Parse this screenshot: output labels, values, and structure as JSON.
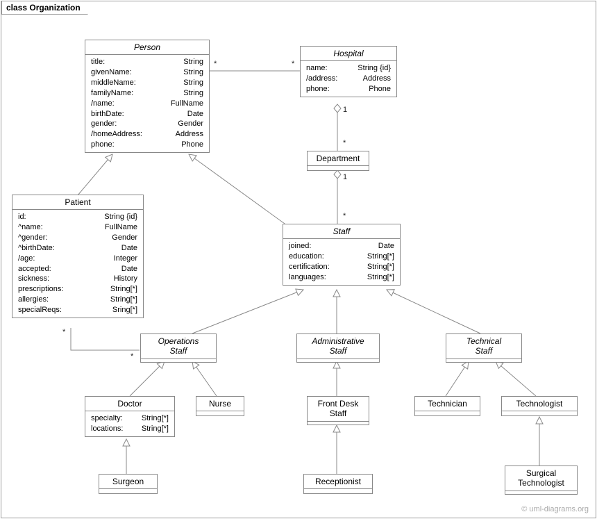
{
  "frame": {
    "title": "class Organization"
  },
  "watermark": "© uml-diagrams.org",
  "classes": {
    "person": {
      "name": "Person",
      "attrs": [
        {
          "n": "title:",
          "t": "String"
        },
        {
          "n": "givenName:",
          "t": "String"
        },
        {
          "n": "middleName:",
          "t": "String"
        },
        {
          "n": "familyName:",
          "t": "String"
        },
        {
          "n": "/name:",
          "t": "FullName"
        },
        {
          "n": "birthDate:",
          "t": "Date"
        },
        {
          "n": "gender:",
          "t": "Gender"
        },
        {
          "n": "/homeAddress:",
          "t": "Address"
        },
        {
          "n": "phone:",
          "t": "Phone"
        }
      ]
    },
    "hospital": {
      "name": "Hospital",
      "attrs": [
        {
          "n": "name:",
          "t": "String {id}"
        },
        {
          "n": "/address:",
          "t": "Address"
        },
        {
          "n": "phone:",
          "t": "Phone"
        }
      ]
    },
    "department": {
      "name": "Department"
    },
    "patient": {
      "name": "Patient",
      "attrs": [
        {
          "n": "id:",
          "t": "String {id}"
        },
        {
          "n": "^name:",
          "t": "FullName"
        },
        {
          "n": "^gender:",
          "t": "Gender"
        },
        {
          "n": "^birthDate:",
          "t": "Date"
        },
        {
          "n": "/age:",
          "t": "Integer"
        },
        {
          "n": "accepted:",
          "t": "Date"
        },
        {
          "n": "sickness:",
          "t": "History"
        },
        {
          "n": "prescriptions:",
          "t": "String[*]"
        },
        {
          "n": "allergies:",
          "t": "String[*]"
        },
        {
          "n": "specialReqs:",
          "t": "Sring[*]"
        }
      ]
    },
    "staff": {
      "name": "Staff",
      "attrs": [
        {
          "n": "joined:",
          "t": "Date"
        },
        {
          "n": "education:",
          "t": "String[*]"
        },
        {
          "n": "certification:",
          "t": "String[*]"
        },
        {
          "n": "languages:",
          "t": "String[*]"
        }
      ]
    },
    "opstaff": {
      "name": "Operations",
      "name2": "Staff"
    },
    "adminstaff": {
      "name": "Administrative",
      "name2": "Staff"
    },
    "techstaff": {
      "name": "Technical",
      "name2": "Staff"
    },
    "doctor": {
      "name": "Doctor",
      "attrs": [
        {
          "n": "specialty:",
          "t": "String[*]"
        },
        {
          "n": "locations:",
          "t": "String[*]"
        }
      ]
    },
    "nurse": {
      "name": "Nurse"
    },
    "frontdesk": {
      "name": "Front Desk",
      "name2": "Staff"
    },
    "technician": {
      "name": "Technician"
    },
    "technologist": {
      "name": "Technologist"
    },
    "surgeon": {
      "name": "Surgeon"
    },
    "receptionist": {
      "name": "Receptionist"
    },
    "surgtech": {
      "name": "Surgical",
      "name2": "Technologist"
    }
  },
  "mult": {
    "ph_person": "*",
    "ph_hospital": "*",
    "hd_hospital": "1",
    "hd_dept": "*",
    "ds_dept": "1",
    "ds_staff": "*",
    "po_patient": "*",
    "po_ops": "*"
  }
}
